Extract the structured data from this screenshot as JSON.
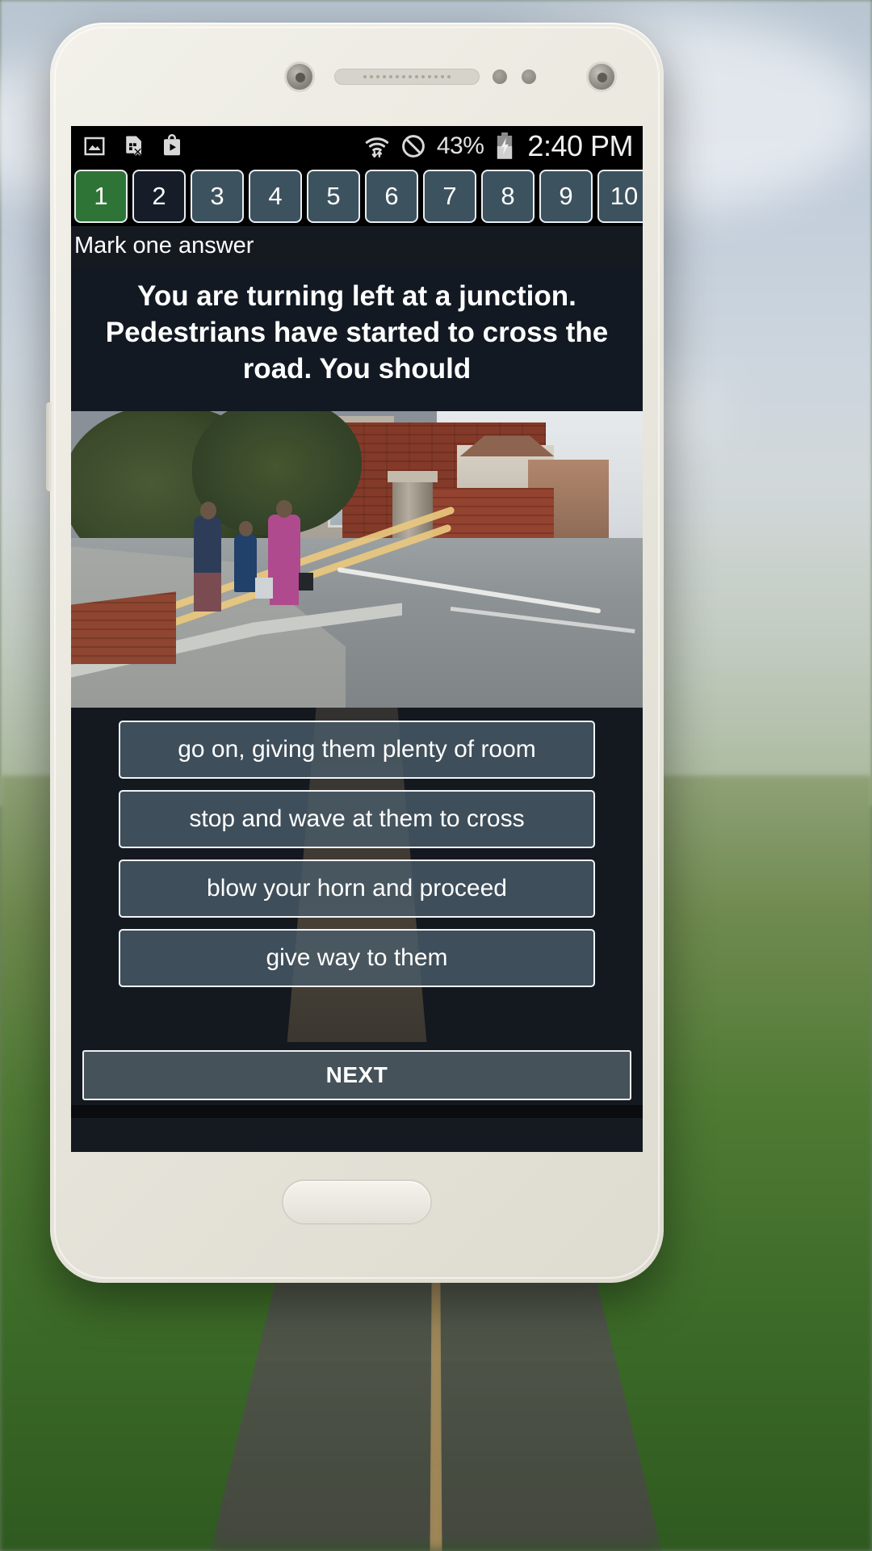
{
  "app": {
    "screen_title": "Driving Theory Test Question"
  },
  "status_bar": {
    "icons_left": [
      "image-icon",
      "sim-card-error-icon",
      "play-store-icon"
    ],
    "wifi_icon": "wifi-data-transfer-icon",
    "dnd_icon": "do-not-disturb-icon",
    "battery_percent": "43%",
    "battery_icon": "battery-charging-icon",
    "time": "2:40 PM"
  },
  "question_tabs": [
    {
      "label": "1",
      "state": "answered"
    },
    {
      "label": "2",
      "state": "current"
    },
    {
      "label": "3",
      "state": "default"
    },
    {
      "label": "4",
      "state": "default"
    },
    {
      "label": "5",
      "state": "default"
    },
    {
      "label": "6",
      "state": "default"
    },
    {
      "label": "7",
      "state": "default"
    },
    {
      "label": "8",
      "state": "default"
    },
    {
      "label": "9",
      "state": "default"
    },
    {
      "label": "10",
      "state": "default"
    }
  ],
  "question": {
    "instruction": "Mark one answer",
    "text": "You are turning left at a junction. Pedestrians have started to cross the road. You should",
    "image_alt": "Residential street junction with pedestrians crossing near double yellow lines"
  },
  "answers": [
    {
      "label": "go on, giving them plenty of room"
    },
    {
      "label": "stop and wave at them to cross"
    },
    {
      "label": "blow your horn and proceed"
    },
    {
      "label": "give way to them"
    }
  ],
  "footer": {
    "next_label": "NEXT"
  },
  "colors": {
    "tab_answered": "#2f7437",
    "tab_current": "#161d29",
    "tab_default": "#3d525f",
    "screen_background": "#151a21",
    "answer_fill": "#4a5e6b",
    "text_primary": "#ffffff"
  }
}
